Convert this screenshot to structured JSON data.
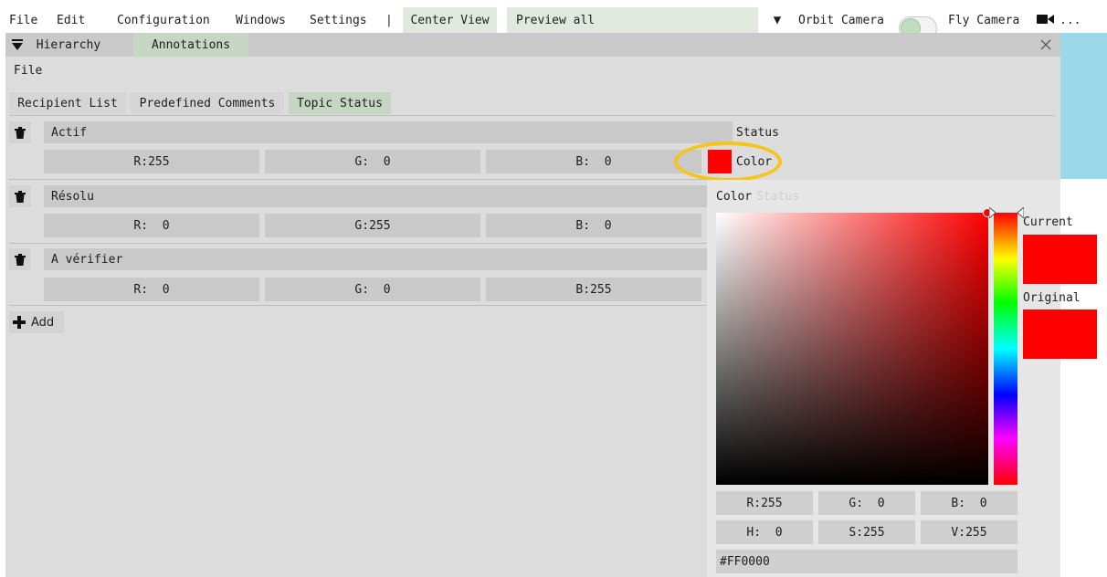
{
  "menubar": {
    "items": [
      "File",
      "Edit",
      "Configuration",
      "Windows",
      "Settings",
      "|",
      "Center View",
      "Preview all"
    ],
    "triangle": "▼",
    "orbit_camera": "Orbit Camera",
    "fly_camera": "Fly Camera",
    "camera_icon": "video-camera-icon",
    "more": "..."
  },
  "window": {
    "collapse_icon": "triangle-down-icon",
    "tabs": [
      "Hierarchy",
      "Annotations"
    ],
    "close_icon": "close-icon",
    "file_label": "File",
    "subtabs": [
      "Recipient List",
      "Predefined Comments",
      "Topic Status"
    ],
    "active_subtab": "Topic Status"
  },
  "topics": [
    {
      "name": "Actif",
      "r": "R:255",
      "g": "G:  0",
      "b": "B:  0",
      "color": "#FF0000"
    },
    {
      "name": "Résolu",
      "r": "R:  0",
      "g": "G:255",
      "b": "B:  0",
      "color": "#00FF00"
    },
    {
      "name": "A vérifier",
      "r": "R:  0",
      "g": "G:  0",
      "b": "B:255",
      "color": "#0000FF"
    }
  ],
  "column_labels": {
    "status": "Status",
    "color": "Color",
    "obscured": "Status"
  },
  "add_label": "Add",
  "color_picker": {
    "title": "Color",
    "current_label": "Current",
    "original_label": "Original",
    "current_color": "#FF0000",
    "original_color": "#FF0000",
    "rgb": [
      "R:255",
      "G:  0",
      "B:  0"
    ],
    "hsv": [
      "H:  0",
      "S:255",
      "V:255"
    ],
    "hex": "#FF0000"
  },
  "colors": {
    "accent_tab": "#c5d6c2",
    "highlight_ring": "#f5c518",
    "side_panel": "#9bd8ea"
  }
}
